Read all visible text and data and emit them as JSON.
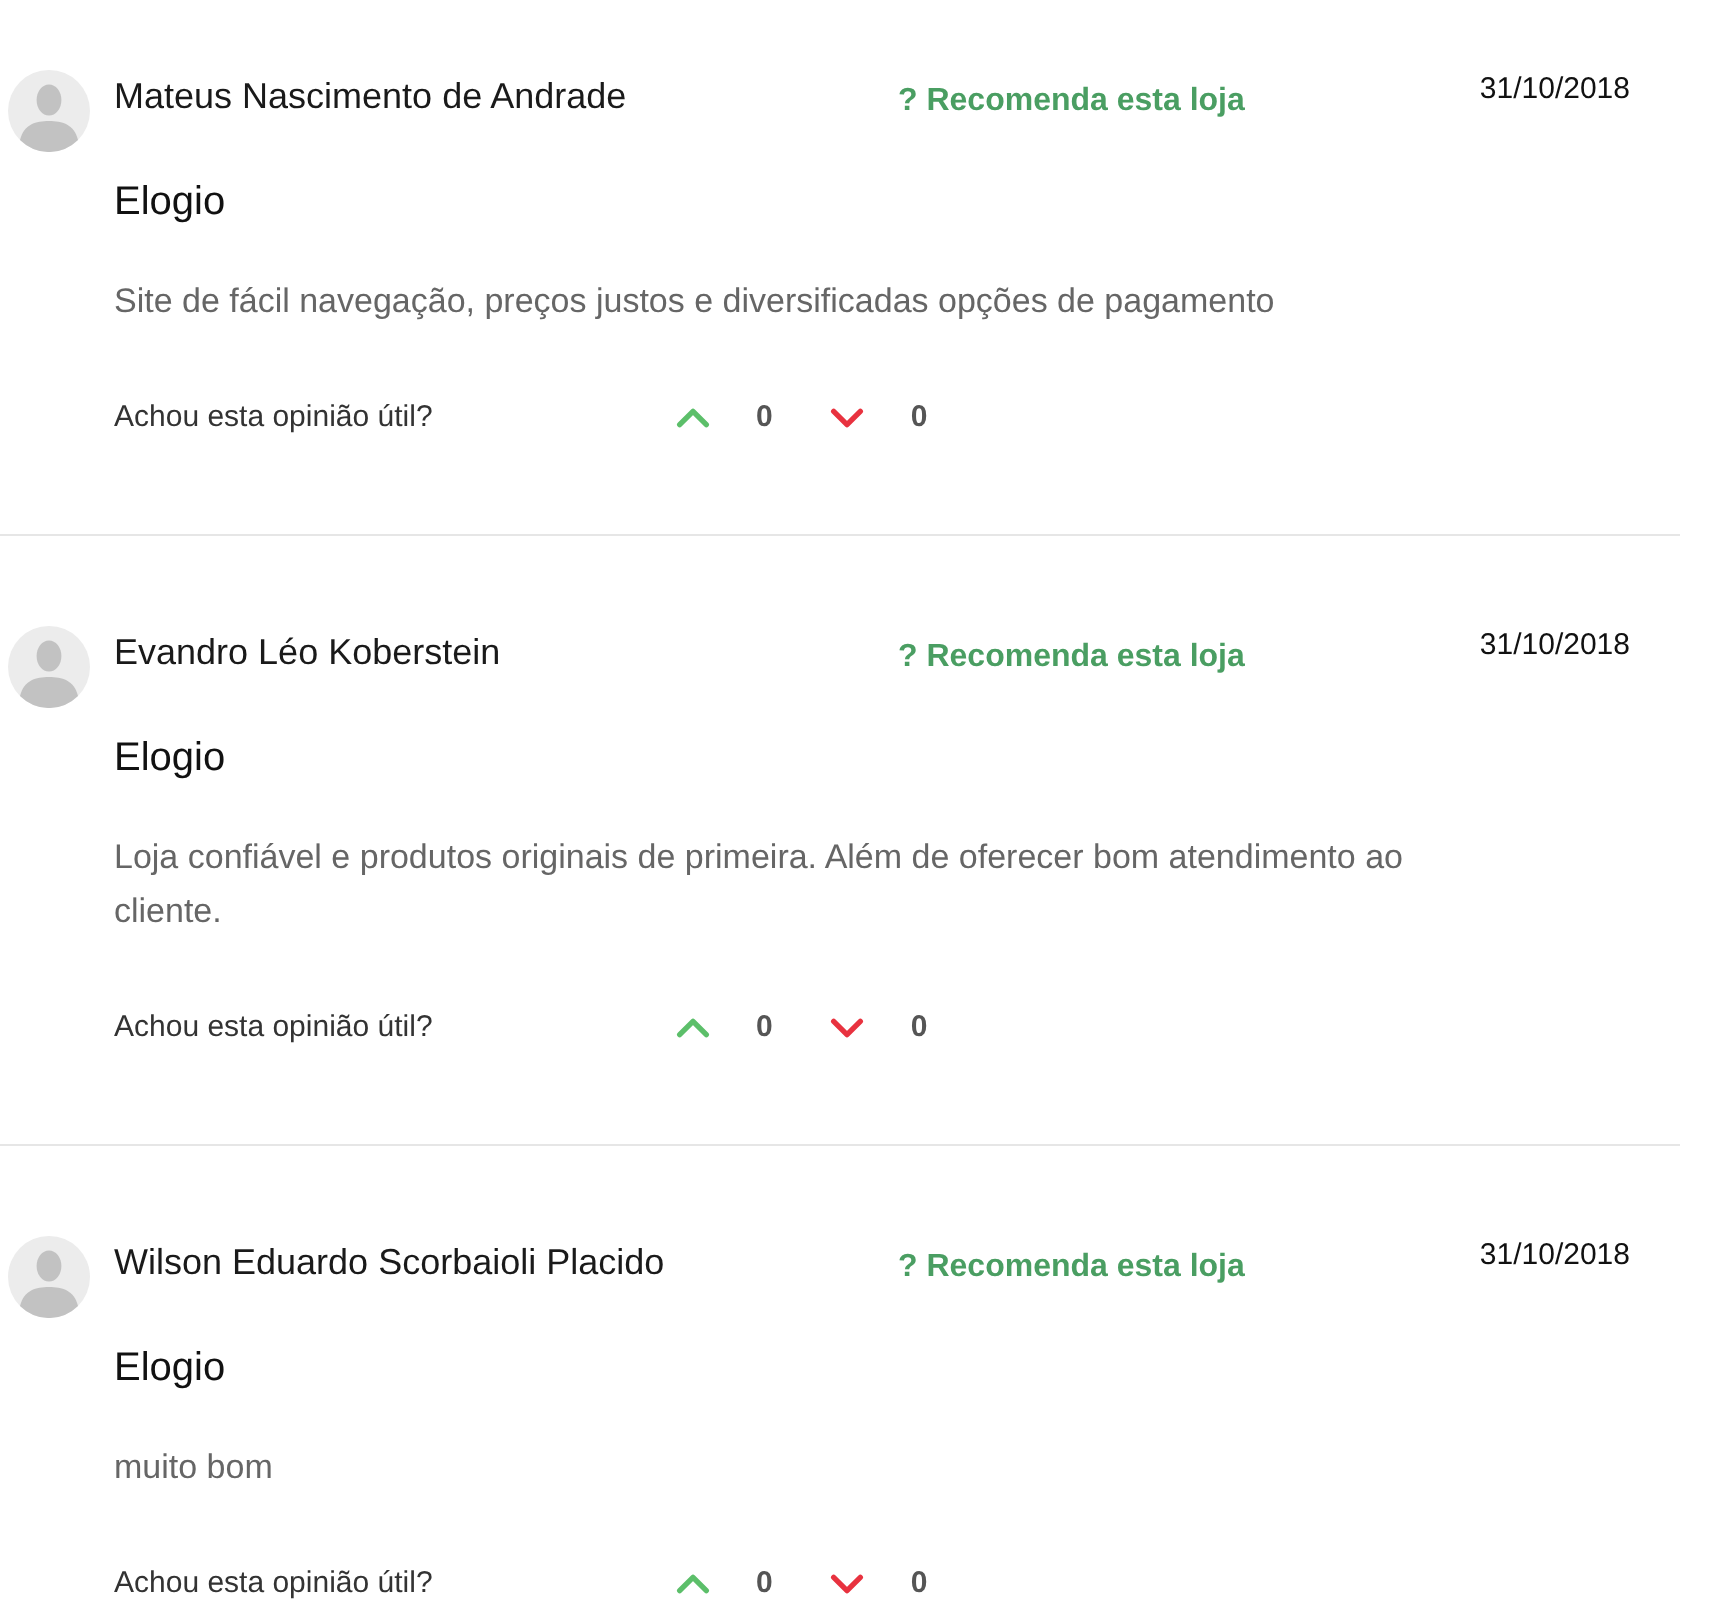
{
  "reviews": [
    {
      "author": "Mateus Nascimento de Andrade",
      "recommendation": "? Recomenda esta loja",
      "date": "31/10/2018",
      "title": "Elogio",
      "text": "Site de fácil navegação, preços justos e diversificadas opções de pagamento",
      "helpful_prompt": "Achou esta opinião útil?",
      "upvotes": "0",
      "downvotes": "0"
    },
    {
      "author": "Evandro Léo Koberstein",
      "recommendation": "? Recomenda esta loja",
      "date": "31/10/2018",
      "title": "Elogio",
      "text": "Loja confiável e produtos originais de primeira. Além de oferecer bom atendimento ao cliente.",
      "helpful_prompt": "Achou esta opinião útil?",
      "upvotes": "0",
      "downvotes": "0"
    },
    {
      "author": "Wilson Eduardo Scorbaioli Placido",
      "recommendation": "? Recomenda esta loja",
      "date": "31/10/2018",
      "title": "Elogio",
      "text": "muito bom",
      "helpful_prompt": "Achou esta opinião útil?",
      "upvotes": "0",
      "downvotes": "0"
    }
  ]
}
